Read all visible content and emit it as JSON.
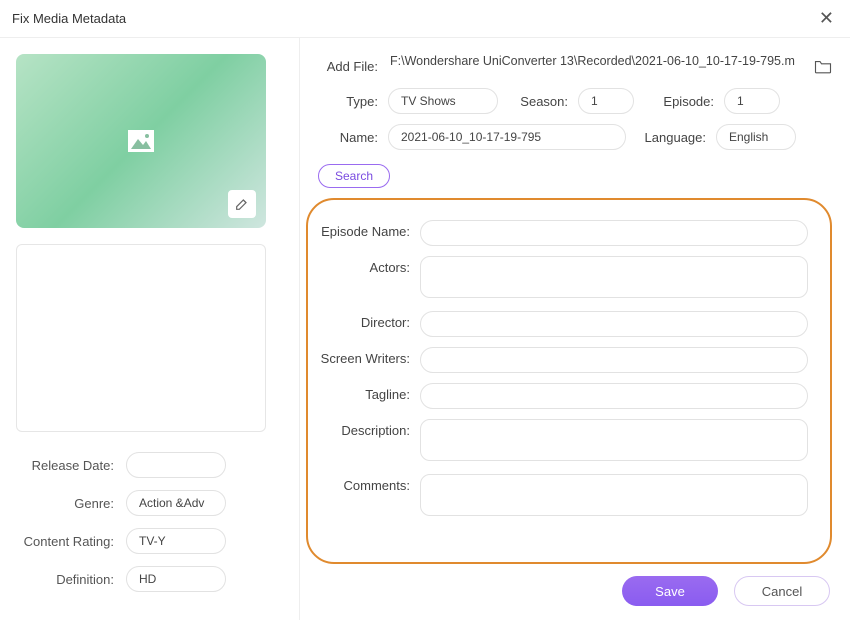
{
  "window": {
    "title": "Fix Media Metadata"
  },
  "left": {
    "labels": {
      "release_date": "Release Date:",
      "genre": "Genre:",
      "content_rating": "Content Rating:",
      "definition": "Definition:"
    },
    "fields": {
      "release_date": "",
      "genre": "Action &Adv",
      "content_rating": "TV-Y",
      "definition": "HD"
    }
  },
  "top": {
    "labels": {
      "add_file": "Add File:",
      "type": "Type:",
      "season": "Season:",
      "episode": "Episode:",
      "name": "Name:",
      "language": "Language:"
    },
    "fields": {
      "add_file": "F:\\Wondershare UniConverter 13\\Recorded\\2021-06-10_10-17-19-795.m",
      "type": "TV Shows",
      "season": "1",
      "episode": "1",
      "name": "2021-06-10_10-17-19-795",
      "language": "English"
    },
    "search_label": "Search"
  },
  "meta": {
    "labels": {
      "episode_name": "Episode Name:",
      "actors": "Actors:",
      "director": "Director:",
      "screen_writers": "Screen Writers:",
      "tagline": "Tagline:",
      "description": "Description:",
      "comments": "Comments:"
    },
    "fields": {
      "episode_name": "",
      "actors": "",
      "director": "",
      "screen_writers": "",
      "tagline": "",
      "description": "",
      "comments": ""
    }
  },
  "footer": {
    "save": "Save",
    "cancel": "Cancel"
  }
}
